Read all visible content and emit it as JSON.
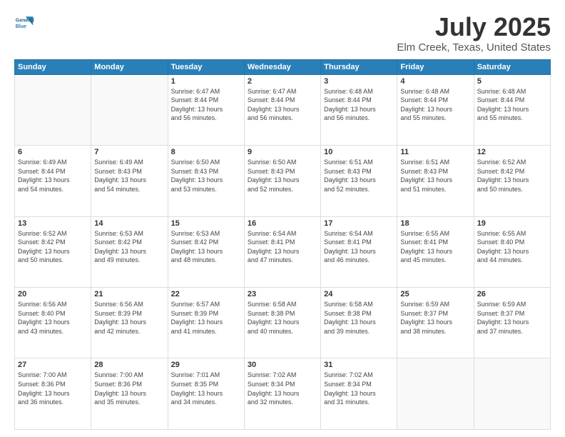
{
  "logo": {
    "line1": "General",
    "line2": "Blue"
  },
  "title": "July 2025",
  "subtitle": "Elm Creek, Texas, United States",
  "headers": [
    "Sunday",
    "Monday",
    "Tuesday",
    "Wednesday",
    "Thursday",
    "Friday",
    "Saturday"
  ],
  "weeks": [
    [
      {
        "day": "",
        "info": ""
      },
      {
        "day": "",
        "info": ""
      },
      {
        "day": "1",
        "info": "Sunrise: 6:47 AM\nSunset: 8:44 PM\nDaylight: 13 hours\nand 56 minutes."
      },
      {
        "day": "2",
        "info": "Sunrise: 6:47 AM\nSunset: 8:44 PM\nDaylight: 13 hours\nand 56 minutes."
      },
      {
        "day": "3",
        "info": "Sunrise: 6:48 AM\nSunset: 8:44 PM\nDaylight: 13 hours\nand 56 minutes."
      },
      {
        "day": "4",
        "info": "Sunrise: 6:48 AM\nSunset: 8:44 PM\nDaylight: 13 hours\nand 55 minutes."
      },
      {
        "day": "5",
        "info": "Sunrise: 6:48 AM\nSunset: 8:44 PM\nDaylight: 13 hours\nand 55 minutes."
      }
    ],
    [
      {
        "day": "6",
        "info": "Sunrise: 6:49 AM\nSunset: 8:44 PM\nDaylight: 13 hours\nand 54 minutes."
      },
      {
        "day": "7",
        "info": "Sunrise: 6:49 AM\nSunset: 8:43 PM\nDaylight: 13 hours\nand 54 minutes."
      },
      {
        "day": "8",
        "info": "Sunrise: 6:50 AM\nSunset: 8:43 PM\nDaylight: 13 hours\nand 53 minutes."
      },
      {
        "day": "9",
        "info": "Sunrise: 6:50 AM\nSunset: 8:43 PM\nDaylight: 13 hours\nand 52 minutes."
      },
      {
        "day": "10",
        "info": "Sunrise: 6:51 AM\nSunset: 8:43 PM\nDaylight: 13 hours\nand 52 minutes."
      },
      {
        "day": "11",
        "info": "Sunrise: 6:51 AM\nSunset: 8:43 PM\nDaylight: 13 hours\nand 51 minutes."
      },
      {
        "day": "12",
        "info": "Sunrise: 6:52 AM\nSunset: 8:42 PM\nDaylight: 13 hours\nand 50 minutes."
      }
    ],
    [
      {
        "day": "13",
        "info": "Sunrise: 6:52 AM\nSunset: 8:42 PM\nDaylight: 13 hours\nand 50 minutes."
      },
      {
        "day": "14",
        "info": "Sunrise: 6:53 AM\nSunset: 8:42 PM\nDaylight: 13 hours\nand 49 minutes."
      },
      {
        "day": "15",
        "info": "Sunrise: 6:53 AM\nSunset: 8:42 PM\nDaylight: 13 hours\nand 48 minutes."
      },
      {
        "day": "16",
        "info": "Sunrise: 6:54 AM\nSunset: 8:41 PM\nDaylight: 13 hours\nand 47 minutes."
      },
      {
        "day": "17",
        "info": "Sunrise: 6:54 AM\nSunset: 8:41 PM\nDaylight: 13 hours\nand 46 minutes."
      },
      {
        "day": "18",
        "info": "Sunrise: 6:55 AM\nSunset: 8:41 PM\nDaylight: 13 hours\nand 45 minutes."
      },
      {
        "day": "19",
        "info": "Sunrise: 6:55 AM\nSunset: 8:40 PM\nDaylight: 13 hours\nand 44 minutes."
      }
    ],
    [
      {
        "day": "20",
        "info": "Sunrise: 6:56 AM\nSunset: 8:40 PM\nDaylight: 13 hours\nand 43 minutes."
      },
      {
        "day": "21",
        "info": "Sunrise: 6:56 AM\nSunset: 8:39 PM\nDaylight: 13 hours\nand 42 minutes."
      },
      {
        "day": "22",
        "info": "Sunrise: 6:57 AM\nSunset: 8:39 PM\nDaylight: 13 hours\nand 41 minutes."
      },
      {
        "day": "23",
        "info": "Sunrise: 6:58 AM\nSunset: 8:38 PM\nDaylight: 13 hours\nand 40 minutes."
      },
      {
        "day": "24",
        "info": "Sunrise: 6:58 AM\nSunset: 8:38 PM\nDaylight: 13 hours\nand 39 minutes."
      },
      {
        "day": "25",
        "info": "Sunrise: 6:59 AM\nSunset: 8:37 PM\nDaylight: 13 hours\nand 38 minutes."
      },
      {
        "day": "26",
        "info": "Sunrise: 6:59 AM\nSunset: 8:37 PM\nDaylight: 13 hours\nand 37 minutes."
      }
    ],
    [
      {
        "day": "27",
        "info": "Sunrise: 7:00 AM\nSunset: 8:36 PM\nDaylight: 13 hours\nand 36 minutes."
      },
      {
        "day": "28",
        "info": "Sunrise: 7:00 AM\nSunset: 8:36 PM\nDaylight: 13 hours\nand 35 minutes."
      },
      {
        "day": "29",
        "info": "Sunrise: 7:01 AM\nSunset: 8:35 PM\nDaylight: 13 hours\nand 34 minutes."
      },
      {
        "day": "30",
        "info": "Sunrise: 7:02 AM\nSunset: 8:34 PM\nDaylight: 13 hours\nand 32 minutes."
      },
      {
        "day": "31",
        "info": "Sunrise: 7:02 AM\nSunset: 8:34 PM\nDaylight: 13 hours\nand 31 minutes."
      },
      {
        "day": "",
        "info": ""
      },
      {
        "day": "",
        "info": ""
      }
    ]
  ]
}
